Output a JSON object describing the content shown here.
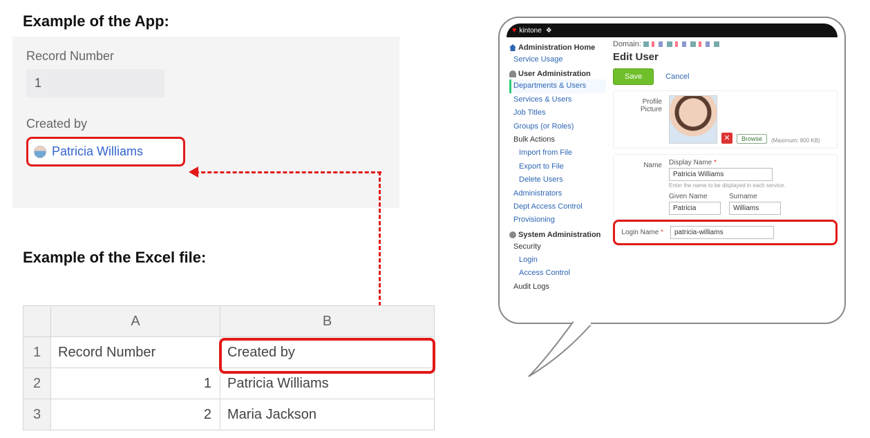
{
  "headings": {
    "app": "Example of the App:",
    "excel": "Example of the Excel file:"
  },
  "app_card": {
    "record_number_label": "Record Number",
    "record_number_value": "1",
    "created_by_label": "Created by",
    "created_by_value": "Patricia Williams"
  },
  "excel": {
    "col_headers": {
      "A": "A",
      "B": "B"
    },
    "row_headers": {
      "r1": "1",
      "r2": "2",
      "r3": "3"
    },
    "rows": [
      {
        "a": "Record Number",
        "b": "Created by"
      },
      {
        "a": "1",
        "b": "Patricia Williams"
      },
      {
        "a": "2",
        "b": "Maria Jackson"
      }
    ]
  },
  "admin": {
    "brand": "kintone",
    "domain_label": "Domain:",
    "title": "Edit User",
    "save": "Save",
    "cancel": "Cancel",
    "side": {
      "admin_home": "Administration Home",
      "service_usage": "Service Usage",
      "user_admin": "User Administration",
      "dept_users": "Departments & Users",
      "services_users": "Services & Users",
      "job_titles": "Job Titles",
      "groups": "Groups (or Roles)",
      "bulk_actions": "Bulk Actions",
      "import_file": "Import from File",
      "export_file": "Export to File",
      "delete_users": "Delete Users",
      "administrators": "Administrators",
      "dept_access": "Dept Access Control",
      "provisioning": "Provisioning",
      "sys_admin": "System Administration",
      "security": "Security",
      "login": "Login",
      "access_control": "Access Control",
      "audit_logs": "Audit Logs"
    },
    "profile": {
      "section_label": "Profile Picture",
      "browse": "Browse",
      "max": "(Maximum: 800 KB)"
    },
    "name": {
      "section_label": "Name",
      "display_name_label": "Display Name",
      "display_name_value": "Patricia Williams",
      "hint": "Enter the name to be displayed in each service.",
      "given_label": "Given Name",
      "given_value": "Patricia",
      "surname_label": "Surname",
      "surname_value": "Williams"
    },
    "login": {
      "section_label": "Login Name",
      "value": "patricia-williams"
    }
  }
}
